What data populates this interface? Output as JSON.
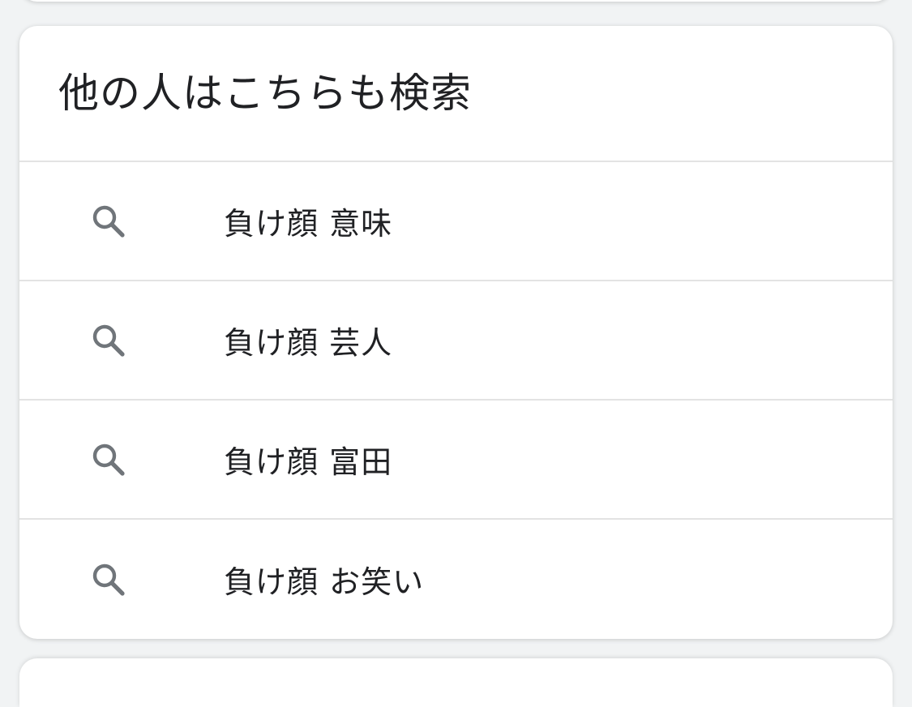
{
  "section": {
    "title": "他の人はこちらも検索"
  },
  "related_searches": [
    {
      "icon": "search-icon",
      "label": "負け顔 意味"
    },
    {
      "icon": "search-icon",
      "label": "負け顔 芸人"
    },
    {
      "icon": "search-icon",
      "label": "負け顔 富田"
    },
    {
      "icon": "search-icon",
      "label": "負け顔 お笑い"
    }
  ],
  "colors": {
    "card_background": "#ffffff",
    "page_background": "#f1f3f4",
    "divider": "#e3e3e3",
    "text": "#202124",
    "icon": "#70757a"
  }
}
